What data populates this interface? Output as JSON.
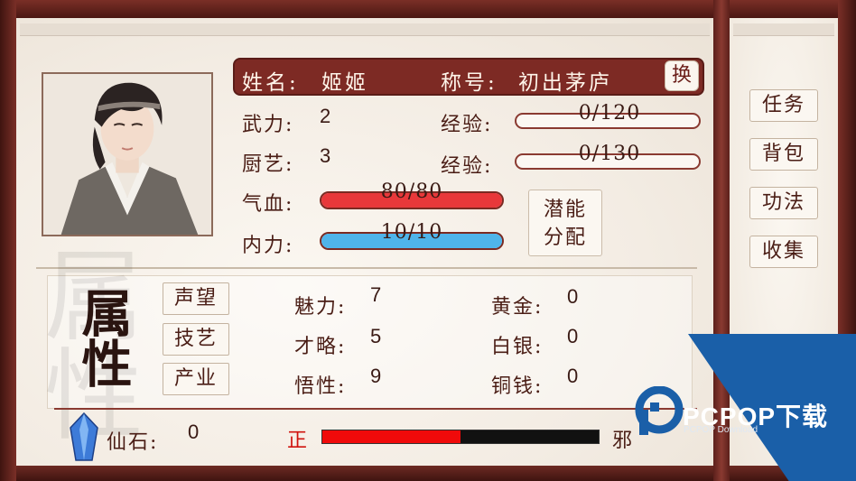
{
  "profile": {
    "name_label": "姓名:",
    "name": "姬姬",
    "title_label": "称号:",
    "title": "初出茅庐",
    "swap_label": "换"
  },
  "attributes": {
    "martial_label": "武力:",
    "martial": "2",
    "cooking_label": "厨艺:",
    "cooking": "3",
    "exp1_label": "经验:",
    "exp1": "0/120",
    "exp2_label": "经验:",
    "exp2": "0/130",
    "hp_label": "气血:",
    "hp": "80/80",
    "hp_fill": 1.0,
    "mp_label": "内力:",
    "mp": "10/10",
    "mp_fill": 1.0,
    "allocate_label_1": "潜能",
    "allocate_label_2": "分配"
  },
  "lower": {
    "calligraphy": "属性",
    "buttons": {
      "reputation": "声望",
      "skills": "技艺",
      "property": "产业"
    },
    "charm_label": "魅力:",
    "charm": "7",
    "strategy_label": "才略:",
    "strategy": "5",
    "insight_label": "悟性:",
    "insight": "9",
    "gold_label": "黄金:",
    "gold": "0",
    "silver_label": "白银:",
    "silver": "0",
    "copper_label": "铜钱:",
    "copper": "0"
  },
  "bottom": {
    "spirit_stone_label": "仙石:",
    "spirit_stone": "0",
    "righteous_label": "正",
    "evil_label": "邪",
    "alignment_fill": 0.5
  },
  "side_menu": {
    "quests": "任务",
    "bag": "背包",
    "kungfu": "功法",
    "collection": "收集"
  },
  "watermark": {
    "brand": "PCPOP下载",
    "sub": "PCPOP Download"
  },
  "colors": {
    "hp_bar": "#e8383a",
    "mp_bar": "#4fb4ea",
    "name_bar": "#7d2a24",
    "alignment_good": "#f00a0a"
  }
}
